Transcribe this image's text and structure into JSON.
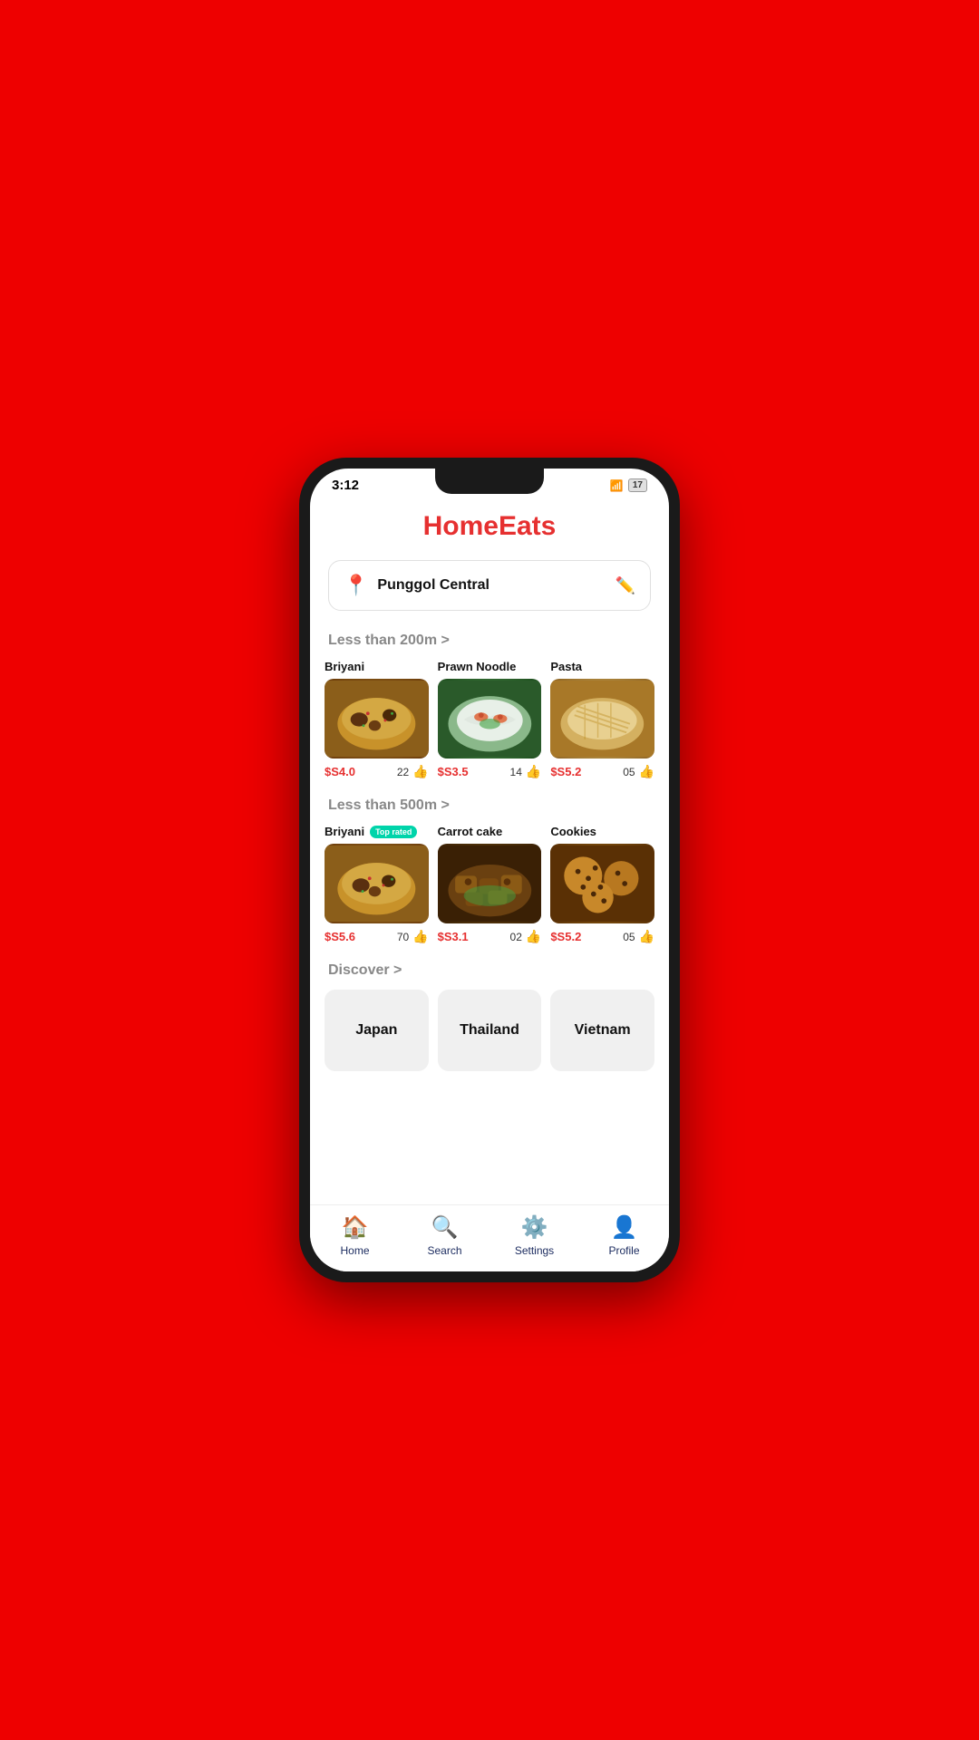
{
  "status_bar": {
    "time": "3:12",
    "wifi": "wifi",
    "battery": "17"
  },
  "app": {
    "title": "HomeEats"
  },
  "location": {
    "text": "Punggol Central",
    "pin_icon": "📍",
    "edit_icon": "✏️"
  },
  "sections": [
    {
      "header": "Less than 200m >",
      "items": [
        {
          "name": "Briyani",
          "price": "$S4.0",
          "likes": "22",
          "top_rated": false,
          "type": "briyani"
        },
        {
          "name": "Prawn Noodle",
          "price": "$S3.5",
          "likes": "14",
          "top_rated": false,
          "type": "prawn"
        },
        {
          "name": "Pasta",
          "price": "$S5.2",
          "likes": "05",
          "top_rated": false,
          "type": "pasta"
        }
      ]
    },
    {
      "header": "Less than 500m >",
      "items": [
        {
          "name": "Briyani",
          "price": "$S5.6",
          "likes": "70",
          "top_rated": true,
          "type": "briyani"
        },
        {
          "name": "Carrot cake",
          "price": "$S3.1",
          "likes": "02",
          "top_rated": false,
          "type": "carrot"
        },
        {
          "name": "Cookies",
          "price": "$S5.2",
          "likes": "05",
          "top_rated": false,
          "type": "cookies"
        }
      ]
    }
  ],
  "discover": {
    "header": "Discover >",
    "items": [
      {
        "label": "Japan"
      },
      {
        "label": "Thailand"
      },
      {
        "label": "Vietnam"
      }
    ]
  },
  "bottom_nav": [
    {
      "label": "Home",
      "icon": "🏠",
      "id": "home"
    },
    {
      "label": "Search",
      "icon": "🔍",
      "id": "search"
    },
    {
      "label": "Settings",
      "icon": "⚙️",
      "id": "settings"
    },
    {
      "label": "Profile",
      "icon": "👤",
      "id": "profile"
    }
  ]
}
